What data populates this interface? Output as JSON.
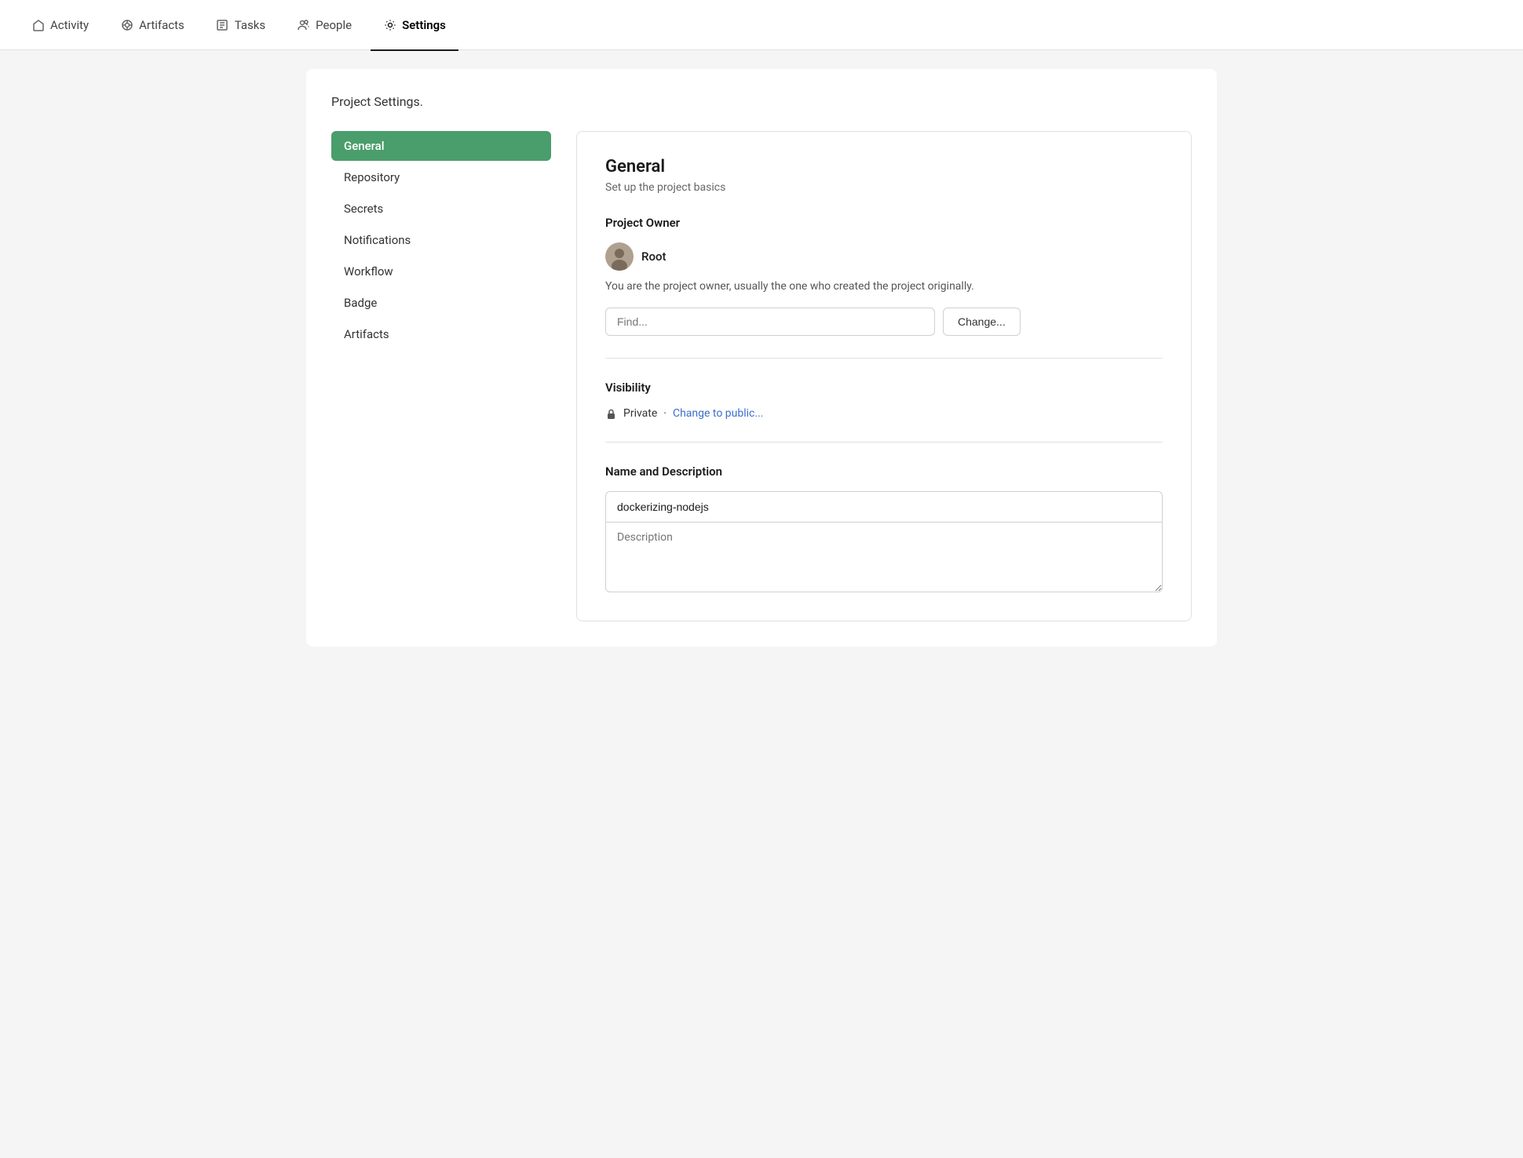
{
  "nav": {
    "items": [
      {
        "id": "activity",
        "label": "Activity",
        "icon": "home-icon",
        "active": false
      },
      {
        "id": "artifacts",
        "label": "Artifacts",
        "icon": "artifacts-icon",
        "active": false
      },
      {
        "id": "tasks",
        "label": "Tasks",
        "icon": "tasks-icon",
        "active": false
      },
      {
        "id": "people",
        "label": "People",
        "icon": "people-icon",
        "active": false
      },
      {
        "id": "settings",
        "label": "Settings",
        "icon": "settings-icon",
        "active": true
      }
    ]
  },
  "page": {
    "title": "Project Settings."
  },
  "sidebar": {
    "items": [
      {
        "id": "general",
        "label": "General",
        "active": true
      },
      {
        "id": "repository",
        "label": "Repository",
        "active": false
      },
      {
        "id": "secrets",
        "label": "Secrets",
        "active": false
      },
      {
        "id": "notifications",
        "label": "Notifications",
        "active": false
      },
      {
        "id": "workflow",
        "label": "Workflow",
        "active": false
      },
      {
        "id": "badge",
        "label": "Badge",
        "active": false
      },
      {
        "id": "artifacts",
        "label": "Artifacts",
        "active": false
      }
    ]
  },
  "general": {
    "title": "General",
    "subtitle": "Set up the project basics",
    "owner_section_label": "Project Owner",
    "owner_name": "Root",
    "owner_description": "You are the project owner, usually the one who created the project originally.",
    "find_placeholder": "Find...",
    "change_button_label": "Change...",
    "visibility_section_label": "Visibility",
    "visibility_status": "Private",
    "visibility_separator": "·",
    "visibility_change_link": "Change to public...",
    "name_description_label": "Name and Description",
    "project_name_value": "dockerizing-nodejs",
    "description_placeholder": "Description"
  }
}
